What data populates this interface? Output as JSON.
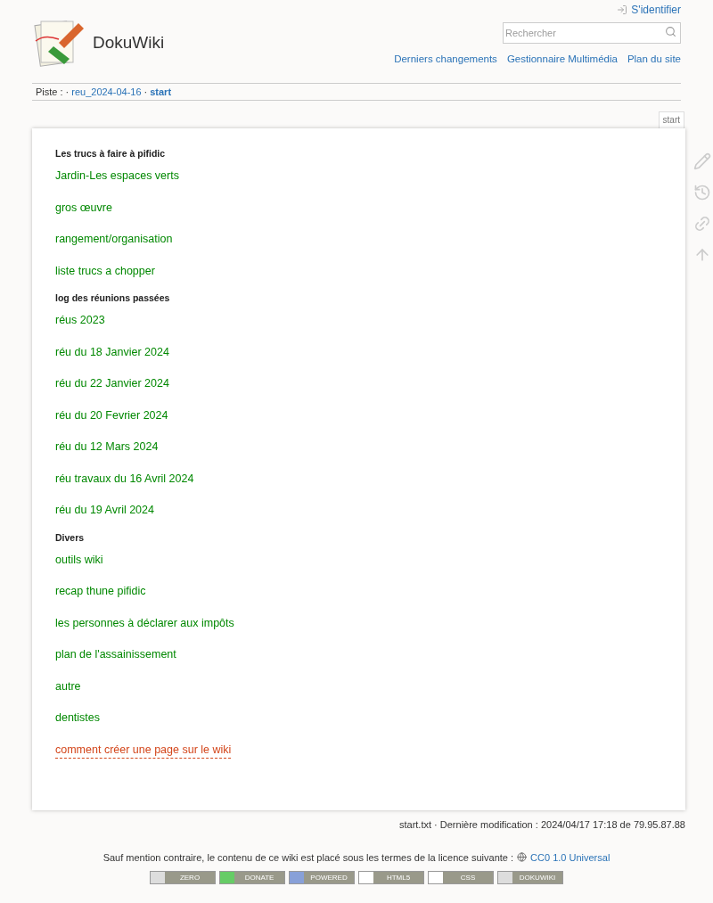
{
  "header": {
    "login": "S'identifier",
    "site_title": "DokuWiki",
    "search": {
      "placeholder": "Rechercher"
    },
    "nav": [
      "Derniers changements",
      "Gestionnaire Multimédia",
      "Plan du site"
    ]
  },
  "breadcrumbs": {
    "label": "Piste :",
    "separator": "·",
    "items": [
      {
        "text": "reu_2024-04-16",
        "selected": false
      },
      {
        "text": "start",
        "selected": true
      }
    ]
  },
  "page_tab": "start",
  "sections": [
    {
      "heading": "Les trucs à faire à pifidic",
      "links": [
        {
          "text": "Jardin-Les espaces verts",
          "kind": "existing"
        },
        {
          "text": "gros œuvre",
          "kind": "existing"
        },
        {
          "text": "rangement/organisation",
          "kind": "existing"
        },
        {
          "text": "liste trucs a chopper",
          "kind": "existing"
        }
      ]
    },
    {
      "heading": "log des réunions passées",
      "links": [
        {
          "text": "réus 2023",
          "kind": "existing"
        },
        {
          "text": "réu du 18 Janvier 2024",
          "kind": "existing"
        },
        {
          "text": "réu du 22 Janvier 2024",
          "kind": "existing"
        },
        {
          "text": "réu du 20 Fevrier 2024",
          "kind": "existing"
        },
        {
          "text": "réu du 12 Mars 2024",
          "kind": "existing"
        },
        {
          "text": "réu travaux du 16 Avril 2024",
          "kind": "existing"
        },
        {
          "text": "réu du 19 Avril 2024",
          "kind": "existing"
        }
      ]
    },
    {
      "heading": "Divers",
      "links": [
        {
          "text": "outils wiki",
          "kind": "existing"
        },
        {
          "text": "recap thune pifidic",
          "kind": "existing"
        },
        {
          "text": "les personnes à déclarer aux impôts",
          "kind": "existing"
        },
        {
          "text": "plan de l'assainissement",
          "kind": "existing"
        },
        {
          "text": "autre",
          "kind": "existing"
        },
        {
          "text": "dentistes",
          "kind": "existing"
        },
        {
          "text": "comment créer une page sur le wiki",
          "kind": "missing"
        }
      ]
    }
  ],
  "doc_info": "start.txt · Dernière modification : 2024/04/17 17:18 de 79.95.87.88",
  "license": {
    "text": "Sauf mention contraire, le contenu de ce wiki est placé sous les termes de la licence suivante :",
    "link": "CC0 1.0 Universal"
  },
  "badges": [
    {
      "label": "ZERO",
      "kind": "cc"
    },
    {
      "label": "DONATE",
      "kind": "donate"
    },
    {
      "label": "POWERED",
      "kind": "php"
    },
    {
      "label": "HTML5",
      "kind": "w3c"
    },
    {
      "label": "CSS",
      "kind": "w3c"
    },
    {
      "label": "DOKUWIKI",
      "kind": "dw"
    }
  ]
}
